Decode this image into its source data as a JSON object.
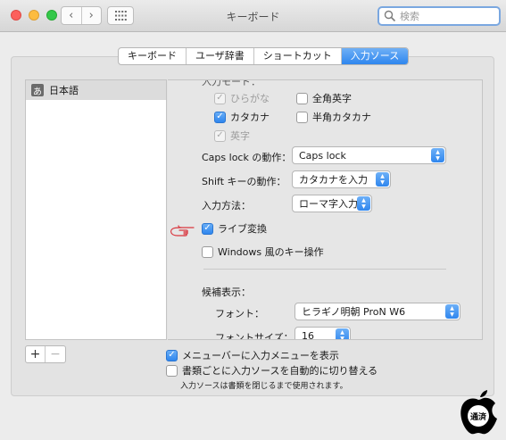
{
  "window": {
    "title": "キーボード",
    "search_placeholder": "検索"
  },
  "tabs": [
    {
      "label": "キーボード",
      "active": false
    },
    {
      "label": "ユーザ辞書",
      "active": false
    },
    {
      "label": "ショートカット",
      "active": false
    },
    {
      "label": "入力ソース",
      "active": true
    }
  ],
  "input_sources": {
    "items": [
      {
        "icon_char": "あ",
        "label": "日本語",
        "selected": true
      }
    ]
  },
  "input_modes": {
    "cut_label": "入力モード：",
    "items": [
      {
        "label": "ひらがな",
        "checked": true,
        "enabled": false
      },
      {
        "label": "全角英字",
        "checked": false,
        "enabled": true
      },
      {
        "label": "カタカナ",
        "checked": true,
        "enabled": true
      },
      {
        "label": "半角カタカナ",
        "checked": false,
        "enabled": true
      },
      {
        "label": "英字",
        "checked": true,
        "enabled": false
      }
    ]
  },
  "caps_lock": {
    "label": "Caps lock の動作：",
    "value": "Caps lock"
  },
  "shift_key": {
    "label": "Shift キーの動作：",
    "value": "カタカナを入力"
  },
  "input_method": {
    "label": "入力方法：",
    "value": "ローマ字入力"
  },
  "live_conversion": {
    "label": "ライブ変換",
    "checked": true
  },
  "windows_keys": {
    "label": "Windows 風のキー操作",
    "checked": false
  },
  "candidates": {
    "heading": "候補表示：",
    "font_label": "フォント：",
    "font_value": "ヒラギノ明朝 ProN W6",
    "size_label": "フォントサイズ：",
    "size_value": "16"
  },
  "bottom": {
    "show_menu": {
      "label": "メニューバーに入力メニューを表示",
      "checked": true
    },
    "auto_switch": {
      "label": "書類ごとに入力ソースを自動的に切り替える",
      "checked": false
    },
    "note": "入力ソースは書類を閉じるまで使用されます。",
    "add_label": "+",
    "remove_label": "−"
  },
  "icons": {
    "back": "chevron-left-icon",
    "forward": "chevron-right-icon",
    "grid": "grid-icon",
    "search": "magnifier-icon",
    "hand": "pointing-hand-icon",
    "logo": "apple-logo"
  },
  "colors": {
    "accent": "#2f86ee",
    "hand": "#d9363e"
  },
  "logo_text": "通済"
}
